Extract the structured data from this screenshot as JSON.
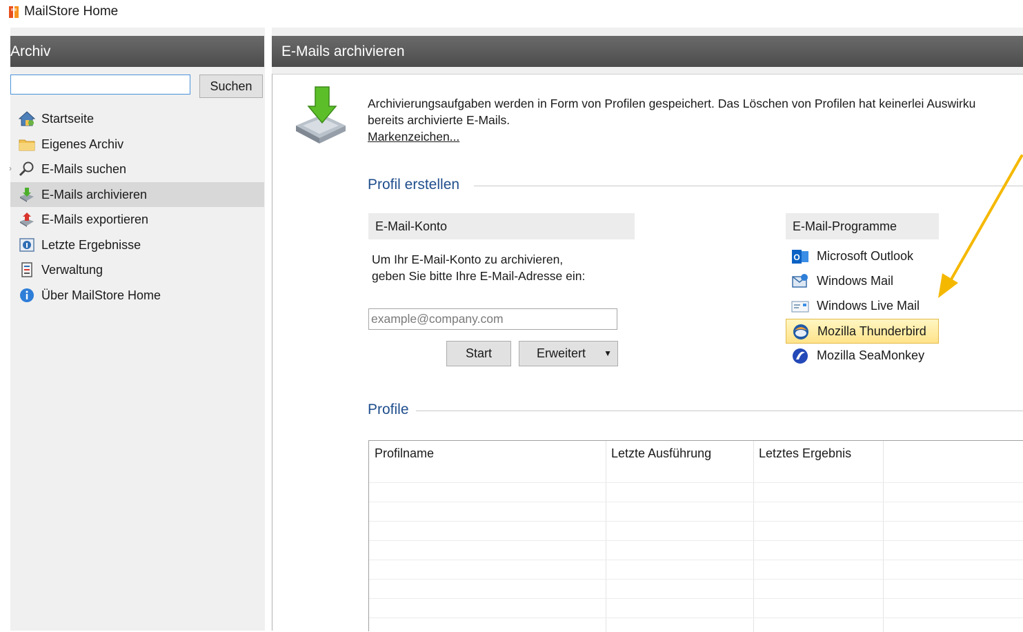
{
  "window": {
    "title": "MailStore Home",
    "icon": "mailstore-logo-icon"
  },
  "sidebar": {
    "header": "Archiv",
    "search": {
      "value": "",
      "placeholder": "",
      "button_label": "Suchen"
    },
    "items": [
      {
        "label": "Startseite",
        "icon": "home-icon"
      },
      {
        "label": "Eigenes Archiv",
        "icon": "folder-icon"
      },
      {
        "label": "E-Mails suchen",
        "icon": "magnifier-icon",
        "expandable": true
      },
      {
        "label": "E-Mails archivieren",
        "icon": "archive-download-icon",
        "selected": true
      },
      {
        "label": "E-Mails exportieren",
        "icon": "export-icon"
      },
      {
        "label": "Letzte Ergebnisse",
        "icon": "results-icon"
      },
      {
        "label": "Verwaltung",
        "icon": "administration-icon"
      },
      {
        "label": "Über MailStore Home",
        "icon": "info-icon"
      }
    ]
  },
  "main": {
    "header": "E-Mails archivieren",
    "intro_line1": "Archivierungsaufgaben werden in Form von Profilen gespeichert. Das Löschen von Profilen hat keinerlei Auswirku",
    "intro_line2": "bereits archivierte E-Mails.",
    "intro_link": "Markenzeichen...",
    "create_profile": {
      "title": "Profil erstellen",
      "account": {
        "header": "E-Mail-Konto",
        "instructions_line1": "Um Ihr E-Mail-Konto zu archivieren,",
        "instructions_line2": "geben Sie bitte Ihre E-Mail-Adresse ein:",
        "email_placeholder": "example@company.com",
        "start_label": "Start",
        "advanced_label": "Erweitert"
      },
      "programs": {
        "header": "E-Mail-Programme",
        "items": [
          {
            "label": "Microsoft Outlook",
            "icon": "outlook-icon"
          },
          {
            "label": "Windows Mail",
            "icon": "windows-mail-icon"
          },
          {
            "label": "Windows Live Mail",
            "icon": "windows-live-mail-icon"
          },
          {
            "label": "Mozilla Thunderbird",
            "icon": "thunderbird-icon",
            "selected": true
          },
          {
            "label": "Mozilla SeaMonkey",
            "icon": "seamonkey-icon"
          }
        ]
      }
    },
    "profiles": {
      "title": "Profile",
      "columns": [
        "Profilname",
        "Letzte Ausführung",
        "Letztes Ergebnis",
        ""
      ],
      "rows": []
    }
  },
  "annotation": {
    "arrow_color": "#f5b800"
  },
  "colors": {
    "section_title": "#1f4e8c",
    "header_bar": "#555555",
    "selected_program": "#ffe38a"
  }
}
